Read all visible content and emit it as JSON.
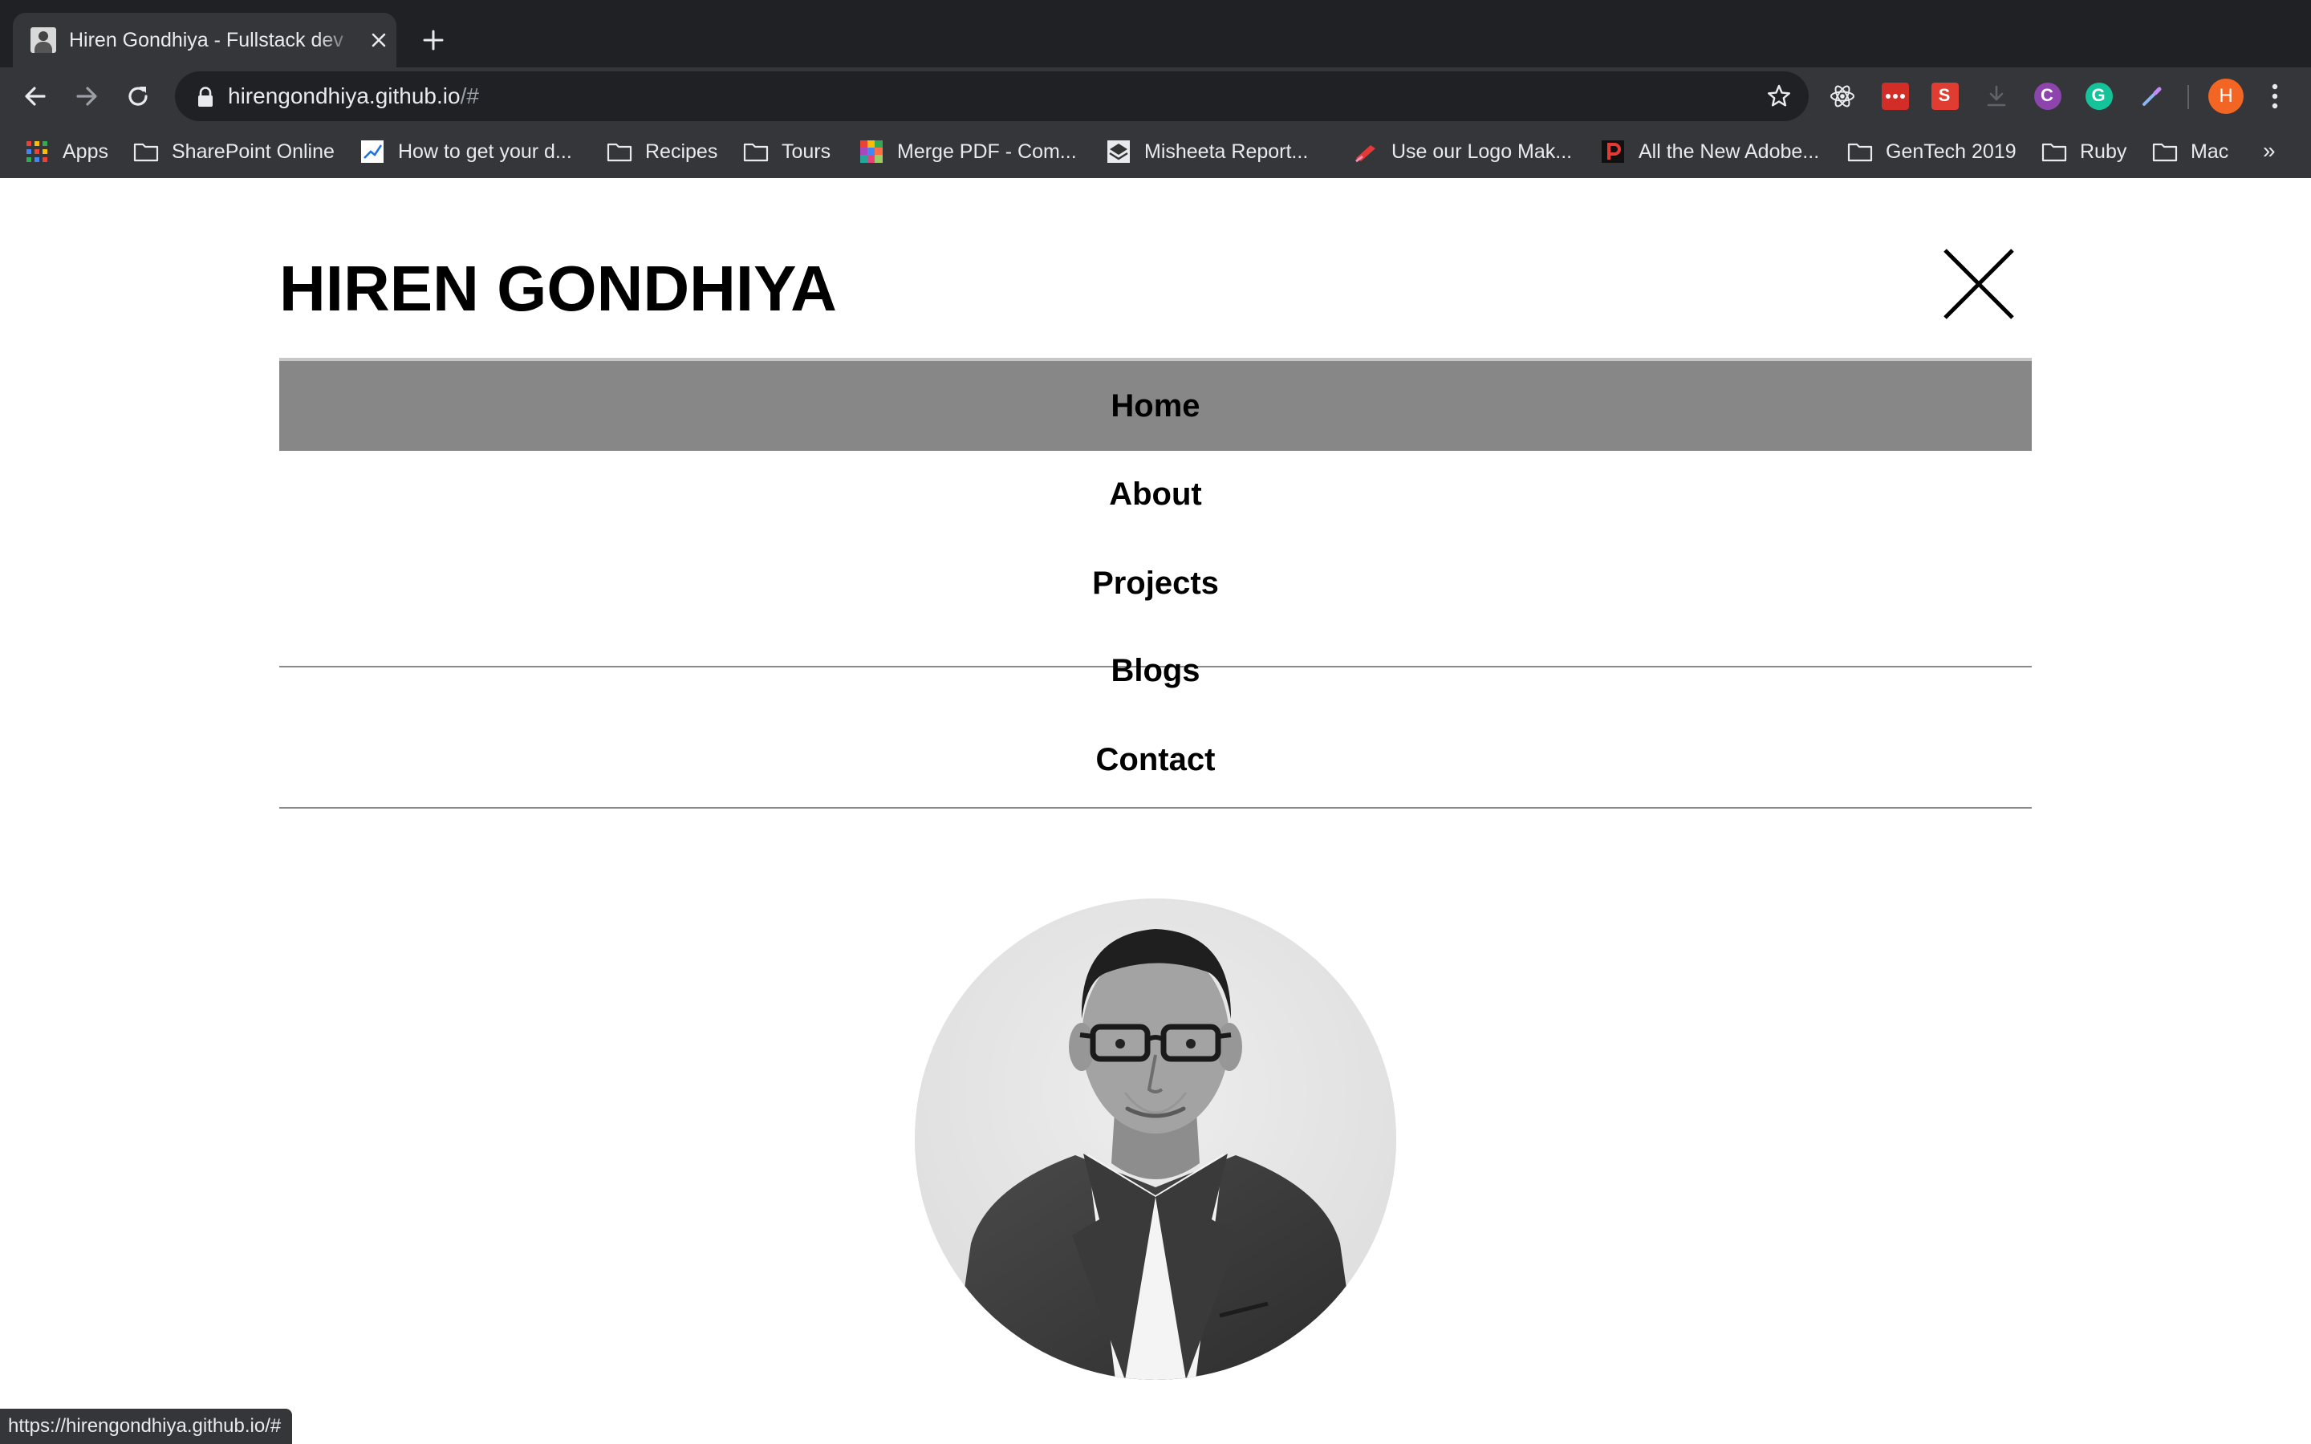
{
  "browser": {
    "tab": {
      "title": "Hiren Gondhiya - Fullstack dev"
    },
    "address": {
      "url_main": "hirengondhiya.github.io",
      "url_rest": "/#"
    },
    "profile": {
      "initial": "H"
    },
    "extensions": [
      {
        "name": "react-devtools-icon",
        "color": "#e8eaed"
      },
      {
        "name": "lastpass-icon",
        "color": "#d32d27"
      },
      {
        "name": "s-extension-icon",
        "color": "#e03c31",
        "letter": "S"
      },
      {
        "name": "download-icon",
        "color": "#5f6368"
      },
      {
        "name": "c-extension-icon",
        "color": "#8e44ad",
        "letter": "C"
      },
      {
        "name": "grammarly-icon",
        "color": "#15c39a",
        "letter": "G"
      },
      {
        "name": "eyedropper-icon",
        "color": "#8ab4f8"
      }
    ],
    "bookmarks": [
      {
        "label": "Apps",
        "icon": "apps-grid-icon"
      },
      {
        "label": "SharePoint Online",
        "icon": "folder-icon"
      },
      {
        "label": "How to get your d...",
        "icon": "chart-favicon-icon"
      },
      {
        "label": "Recipes",
        "icon": "folder-icon"
      },
      {
        "label": "Tours",
        "icon": "folder-icon"
      },
      {
        "label": "Merge PDF - Com...",
        "icon": "colorful-favicon-icon"
      },
      {
        "label": "Misheeta Report...",
        "icon": "layers-favicon-icon"
      },
      {
        "label": "Use our Logo Mak...",
        "icon": "logo-maker-favicon-icon"
      },
      {
        "label": "All the New Adobe...",
        "icon": "p-favicon-icon"
      },
      {
        "label": "GenTech 2019",
        "icon": "folder-icon"
      },
      {
        "label": "Ruby",
        "icon": "folder-icon"
      },
      {
        "label": "Mac",
        "icon": "folder-icon"
      }
    ],
    "bookmarks_overflow": "»",
    "status_url": "https://hirengondhiya.github.io/#"
  },
  "site": {
    "title": "HIREN GONDHIYA",
    "nav": [
      {
        "label": "Home",
        "active": true
      },
      {
        "label": "About",
        "active": false
      },
      {
        "label": "Projects",
        "active": false
      },
      {
        "label": "Blogs",
        "active": false
      },
      {
        "label": "Contact",
        "active": false
      }
    ]
  }
}
